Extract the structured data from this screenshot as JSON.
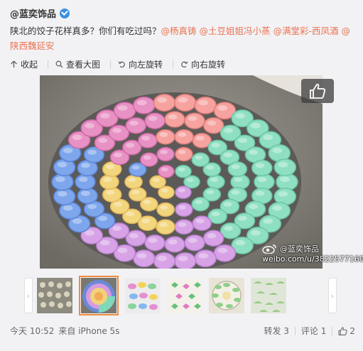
{
  "post": {
    "author": "@蓝奕饰品",
    "text_plain": "陕北的饺子花样真多？你们有吃过吗？",
    "mentions": [
      "@杨真铸",
      "@土豆姐姐冯小蒸",
      "@满堂彩-西凤酒",
      "@陕西魏延安"
    ]
  },
  "toolbar": {
    "collapse": "收起",
    "view_large": "查看大图",
    "rotate_left": "向左旋转",
    "rotate_right": "向右旋转"
  },
  "image": {
    "watermark_brand": "@蓝奕饰品",
    "watermark_url": "weibo.com/u/3822577160"
  },
  "thumbnails": {
    "count": 6,
    "active_index": 1
  },
  "footer": {
    "time": "今天 10:52",
    "source": "来自 iPhone 5s",
    "repost": "转发 3",
    "comment": "评论 1",
    "like_count": "2"
  },
  "colors": {
    "mention": "#eb7350",
    "active_thumb_border": "#f08b3e",
    "verified_badge": "#3a8fe0"
  },
  "icons": [
    "verified-icon",
    "collapse-icon",
    "search-icon",
    "rotate-left-icon",
    "rotate-right-icon",
    "thumbs-up-icon",
    "chevron-left-icon",
    "chevron-right-icon",
    "weibo-logo-icon"
  ]
}
